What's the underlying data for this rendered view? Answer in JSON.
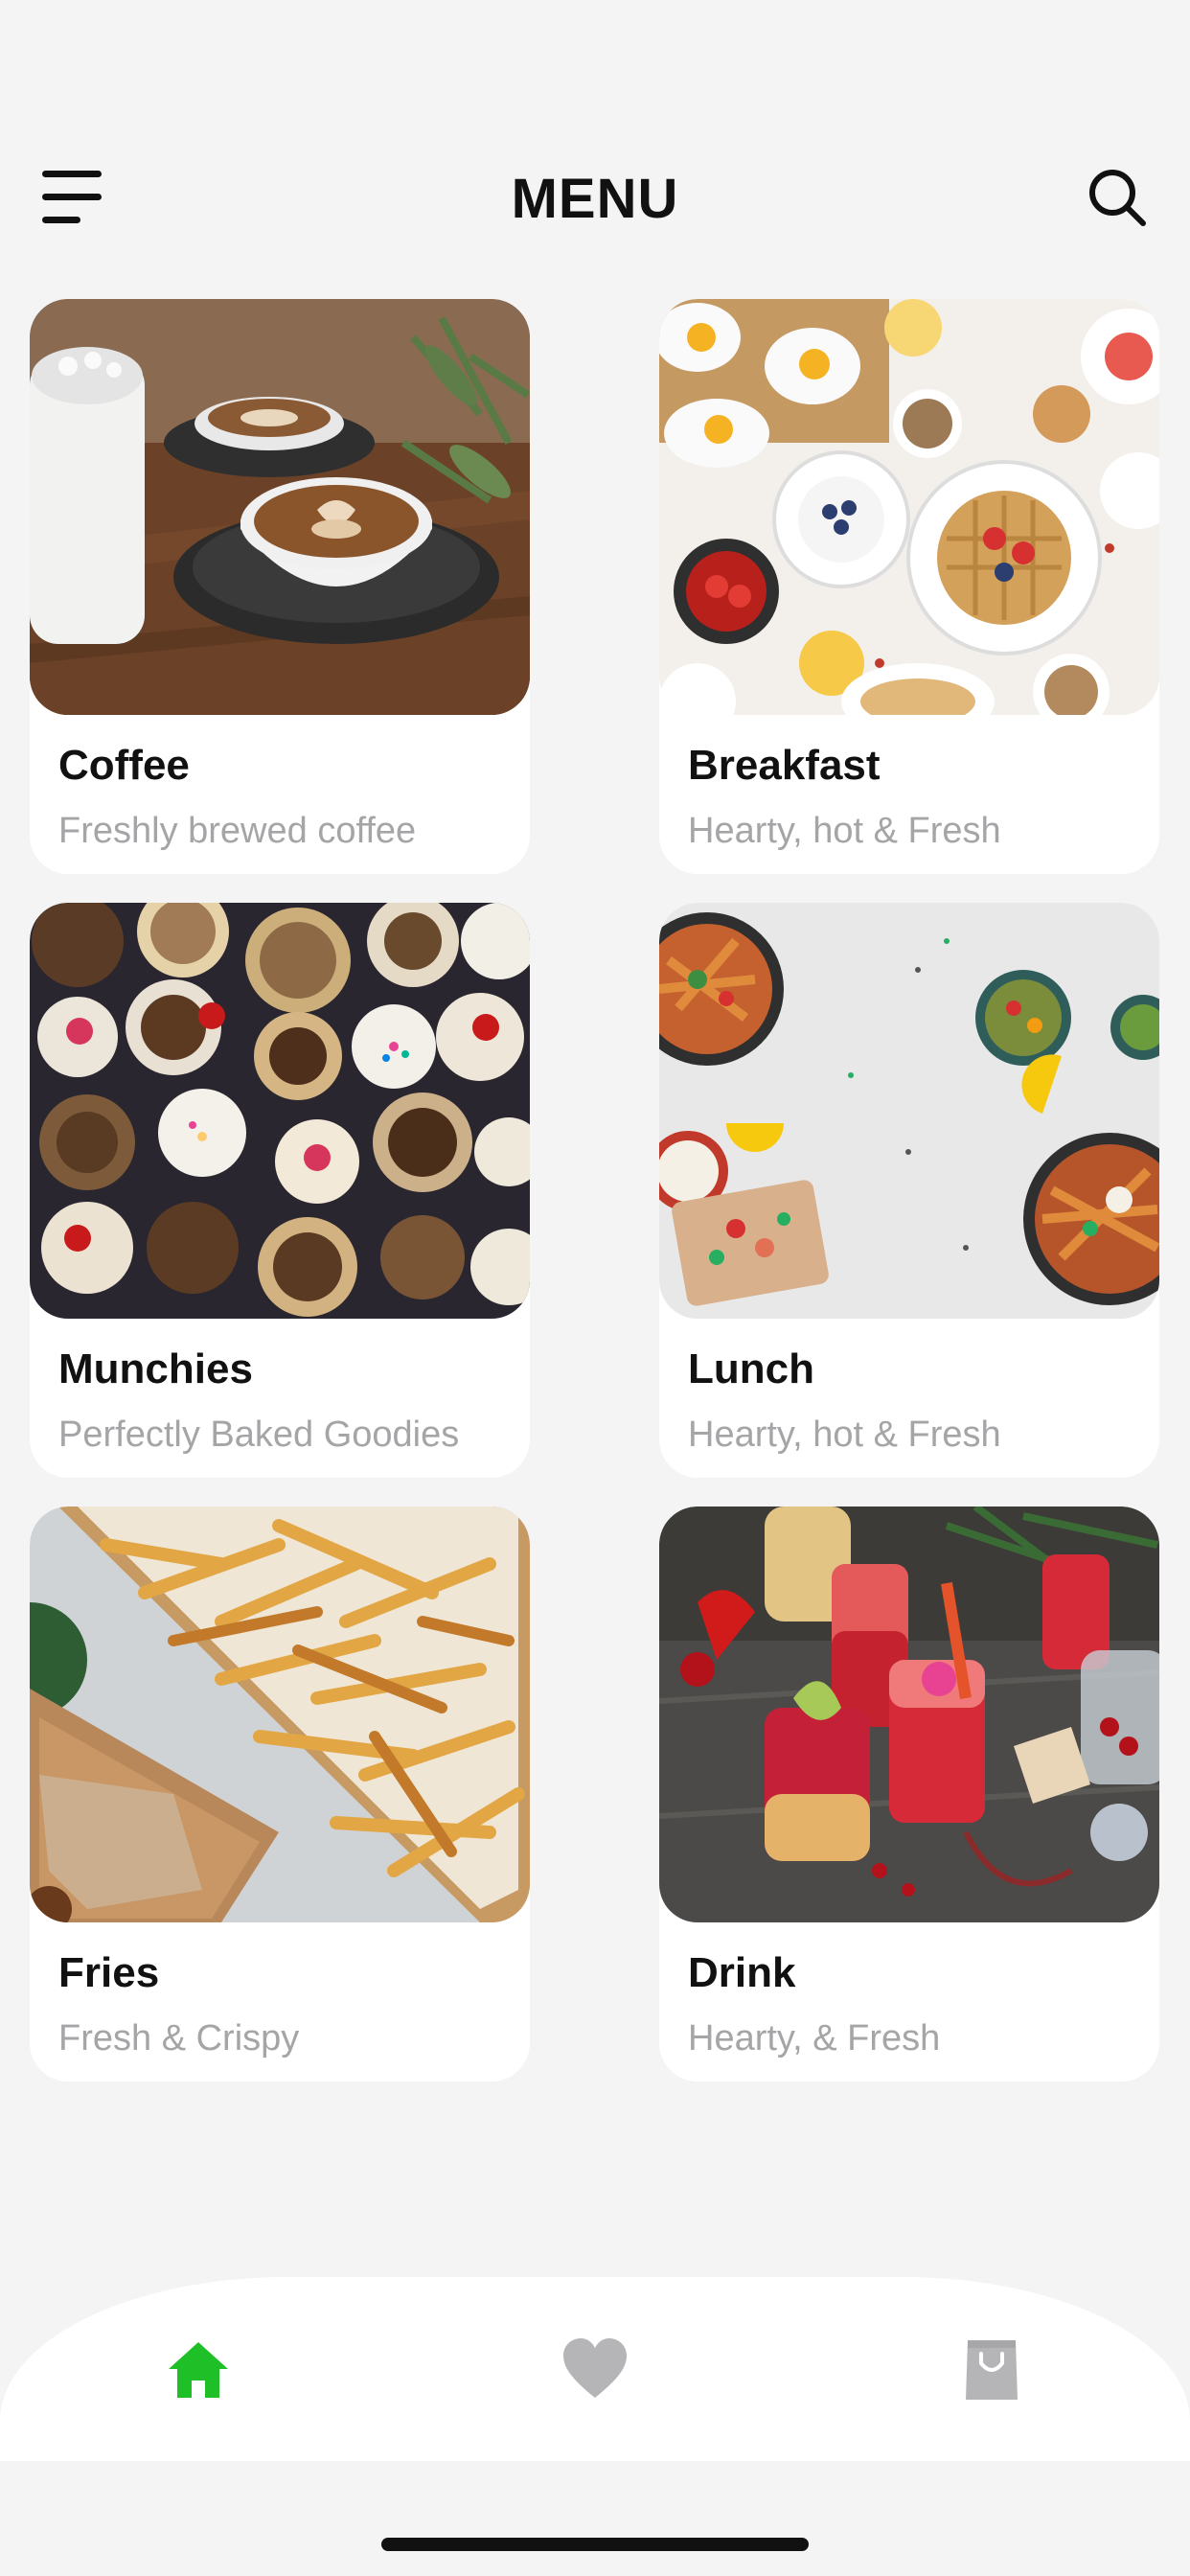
{
  "header": {
    "title": "MENU"
  },
  "menu_items": [
    {
      "name": "Coffee",
      "description": "Freshly brewed coffee"
    },
    {
      "name": "Breakfast",
      "description": "Hearty, hot & Fresh"
    },
    {
      "name": "Munchies",
      "description": "Perfectly Baked Goodies"
    },
    {
      "name": "Lunch",
      "description": "Hearty, hot & Fresh"
    },
    {
      "name": "Fries",
      "description": "Fresh & Crispy"
    },
    {
      "name": "Drink",
      "description": "Hearty, & Fresh"
    }
  ],
  "bottom_nav": {
    "items": [
      "home-icon",
      "heart-icon",
      "bag-icon"
    ],
    "active": "home-icon"
  },
  "colors": {
    "active": "#1fbf28",
    "inactive": "#b5b5b8",
    "background": "#f4f4f5",
    "card": "#ffffff"
  }
}
